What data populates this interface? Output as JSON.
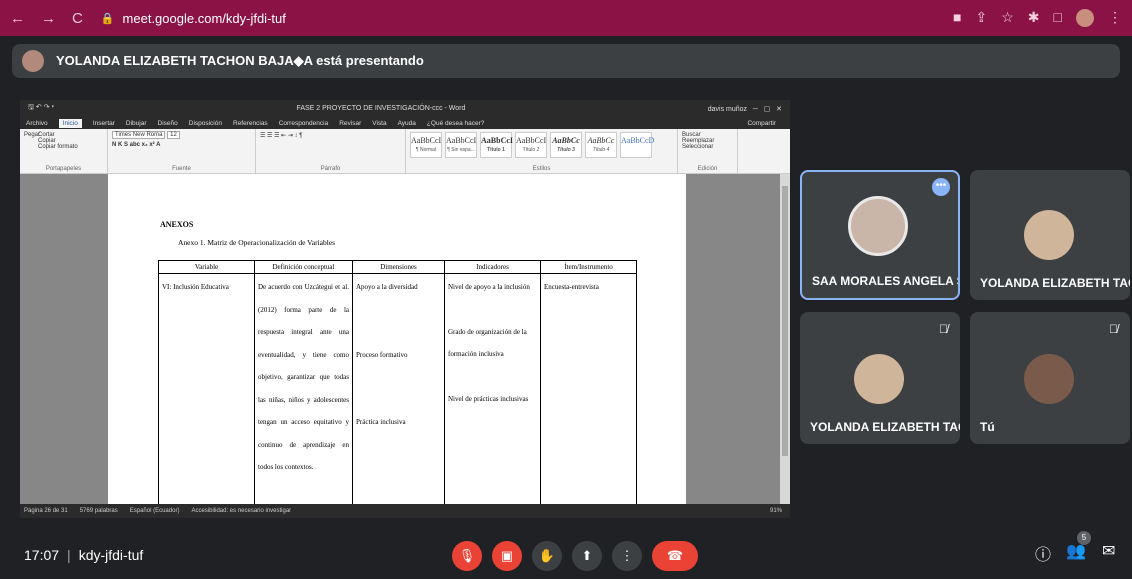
{
  "browser": {
    "url": "meet.google.com/kdy-jfdi-tuf"
  },
  "presenting": {
    "text": "YOLANDA ELIZABETH TACHON BAJA◆A está presentando"
  },
  "word": {
    "doc_title": "FASE 2 PROYECTO DE INVESTIGACIÓN-ccc - Word",
    "user": "davis muñoz",
    "tabs": [
      "Archivo",
      "Inicio",
      "Insertar",
      "Dibujar",
      "Diseño",
      "Disposición",
      "Referencias",
      "Correspondencia",
      "Revisar",
      "Vista",
      "Ayuda",
      "¿Qué desea hacer?"
    ],
    "share": "Compartir",
    "ribbon": {
      "clipboard": {
        "paste": "Pegar",
        "cut": "Cortar",
        "copy": "Copiar",
        "format": "Copiar formato",
        "label": "Portapapeles"
      },
      "font": {
        "name": "Times New Roma",
        "size": "12",
        "label": "Fuente"
      },
      "paragraph_label": "Párrafo",
      "styles": [
        {
          "sample": "AaBbCcI",
          "name": "¶ Normal"
        },
        {
          "sample": "AaBbCcI",
          "name": "¶ Sin espa..."
        },
        {
          "sample": "AaBbCcI",
          "name": "Título 1"
        },
        {
          "sample": "AaBbCcI",
          "name": "Título 2"
        },
        {
          "sample": "AaBbCc",
          "name": "Título 3"
        },
        {
          "sample": "AaBbCc",
          "name": "Título 4"
        },
        {
          "sample": "AaBbCcD",
          "name": ""
        }
      ],
      "styles_label": "Estilos",
      "editing": {
        "find": "Buscar",
        "replace": "Reemplazar",
        "select": "Seleccionar",
        "label": "Edición"
      }
    },
    "page": {
      "heading": "ANEXOS",
      "subheading": "Anexo 1. Matriz de Operacionalización de Variables",
      "table": {
        "headers": [
          "Variable",
          "Definición conceptual",
          "Dimensiones",
          "Indicadores",
          "Ítem/Instrumento"
        ],
        "row": {
          "variable": "VI: Inclusión Educativa",
          "definition": "De acuerdo con Uzcátegui et al. (2012) forma parte de la respuesta integral ante una eventualidad, y tiene como objetivo, garantizar que todas las niñas, niños y adolescentes tengan un acceso equitativo y continuo de aprendizaje en todos los contextos.",
          "dimensions": [
            "Apoyo a la diversidad",
            "Proceso formativo",
            "Práctica inclusiva"
          ],
          "indicators": [
            "Nivel de apoyo a la inclusión",
            "Grado de organización de la formación inclusiva",
            "Nivel de prácticas inclusivas"
          ],
          "instrument": "Encuesta-entrevista"
        }
      }
    },
    "status": {
      "page": "Página 26 de 31",
      "words": "5769 palabras",
      "lang": "Español (Ecuador)",
      "accessibility": "Accesibilidad: es necesario investigar",
      "zoom": "91%"
    }
  },
  "participants": [
    {
      "name": "SAA MORALES ANGELA SE..."
    },
    {
      "name": "YOLANDA ELIZABETH TAC..."
    },
    {
      "name": "YOLANDA ELIZABETH TAC..."
    },
    {
      "name": "Tú"
    }
  ],
  "bottom": {
    "time": "17:07",
    "meeting_code": "kdy-jfdi-tuf",
    "people_count": "5"
  },
  "colors": {
    "browser_bar": "#8b1245",
    "end_call": "#ea4335",
    "active_border": "#8ab4f8"
  }
}
